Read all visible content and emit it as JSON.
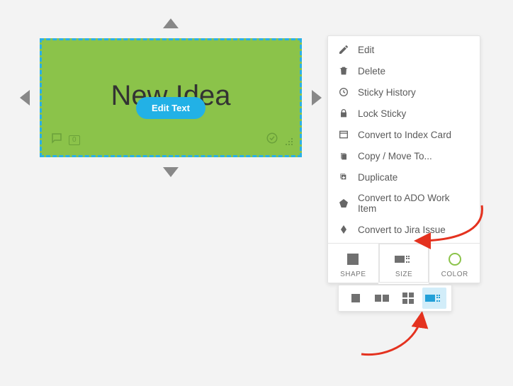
{
  "sticky": {
    "text": "New Idea",
    "edit_pill_label": "Edit Text",
    "comment_count": "0",
    "fill_color": "#8bc34a"
  },
  "menu": {
    "items": [
      {
        "id": "edit",
        "label": "Edit",
        "icon": "pencil"
      },
      {
        "id": "delete",
        "label": "Delete",
        "icon": "trash"
      },
      {
        "id": "history",
        "label": "Sticky History",
        "icon": "clock"
      },
      {
        "id": "lock",
        "label": "Lock Sticky",
        "icon": "lock"
      },
      {
        "id": "index",
        "label": "Convert to Index Card",
        "icon": "card"
      },
      {
        "id": "copymove",
        "label": "Copy / Move To...",
        "icon": "copy"
      },
      {
        "id": "duplicate",
        "label": "Duplicate",
        "icon": "dup"
      },
      {
        "id": "ado",
        "label": "Convert to ADO Work Item",
        "icon": "ado"
      },
      {
        "id": "jira",
        "label": "Convert to Jira Issue",
        "icon": "jira"
      }
    ],
    "bottom": {
      "shape": "SHAPE",
      "size": "SIZE",
      "color": "COLOR",
      "color_swatch": "#8bc34a"
    }
  },
  "size_options": {
    "selected_index": 3,
    "count": 4
  }
}
